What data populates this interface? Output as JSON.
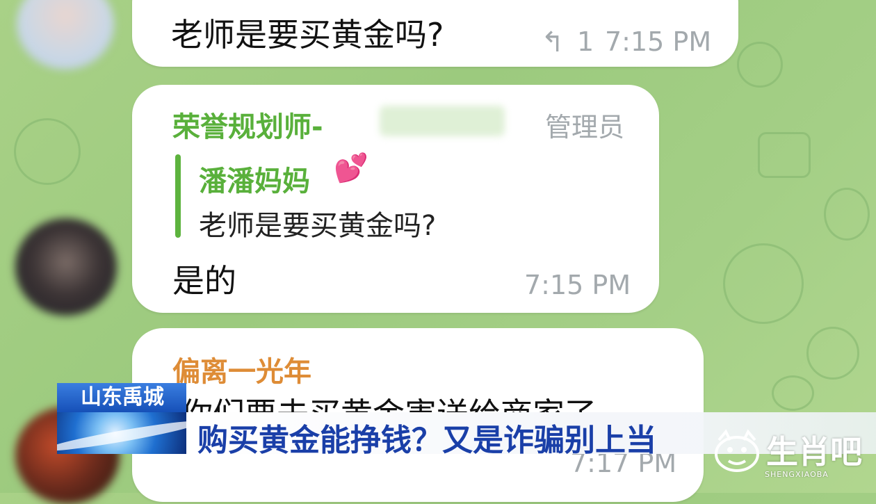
{
  "messages": [
    {
      "text": "老师是要买黄金吗?",
      "reply_icon": "reply-arrow-icon",
      "reply_count": "1",
      "time": "7:15 PM"
    },
    {
      "sender": "荣誉规划师-",
      "role": "管理员",
      "quote": {
        "sender": "潘潘妈妈",
        "emoji": "💕",
        "text": "老师是要买黄金吗?"
      },
      "text": "是的",
      "time": "7:15 PM"
    },
    {
      "sender": "偏离一光年",
      "text": "你们要去买黄金害送给商家了",
      "time": "7:17 PM"
    }
  ],
  "news": {
    "location": "山东禹城",
    "headline": "购买黄金能挣钱？又是诈骗别上当",
    "accent": "#1a3fa8"
  },
  "watermark": {
    "brand": "生肖吧",
    "sub": "SHENGXIAOBA"
  },
  "colors": {
    "chat_bg": "#a4cf86",
    "sender_green": "#59b03b",
    "sender_orange": "#de8c36",
    "time_gray": "#a3a9ad"
  }
}
